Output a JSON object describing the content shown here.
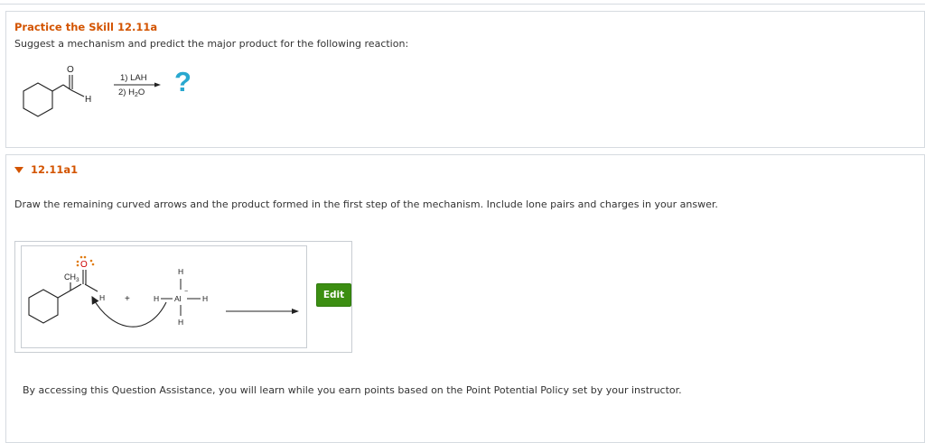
{
  "practice": {
    "title": "Practice the Skill 12.11a",
    "instruction": "Suggest a mechanism and predict the major product for the following reaction:",
    "reaction": {
      "carbonyl_o": "O",
      "aldehyde_h": "H",
      "reagent_1": "1) LAH",
      "reagent_2_prefix": "2) H",
      "reagent_2_sub": "2",
      "reagent_2_suffix": "O",
      "unknown_product": "?"
    }
  },
  "step": {
    "label": "12.11a1",
    "instruction": "Draw the remaining curved arrows and the product formed in the first step of the mechanism. Include lone pairs and charges in your answer.",
    "drawing": {
      "ch3": "CH",
      "ch3_sub": "3",
      "oxygen": "O",
      "h_left": "H",
      "plus": "+",
      "h_top": "H",
      "h_al_left": "H",
      "al": "Al",
      "al_charge": "−",
      "h_al_right": "H",
      "h_bottom": "H"
    },
    "edit_label": "Edit",
    "assistance_note": "By accessing this Question Assistance, you will learn while you earn points based on the Point Potential Policy set by your instructor."
  },
  "colors": {
    "title_orange": "#d35400",
    "question_mark_blue": "#29a8cf",
    "lone_pair_orange": "#e07b10",
    "oxygen_red": "#cc0000",
    "edit_green": "#3c8e12",
    "border_gray": "#d6dbe0"
  }
}
